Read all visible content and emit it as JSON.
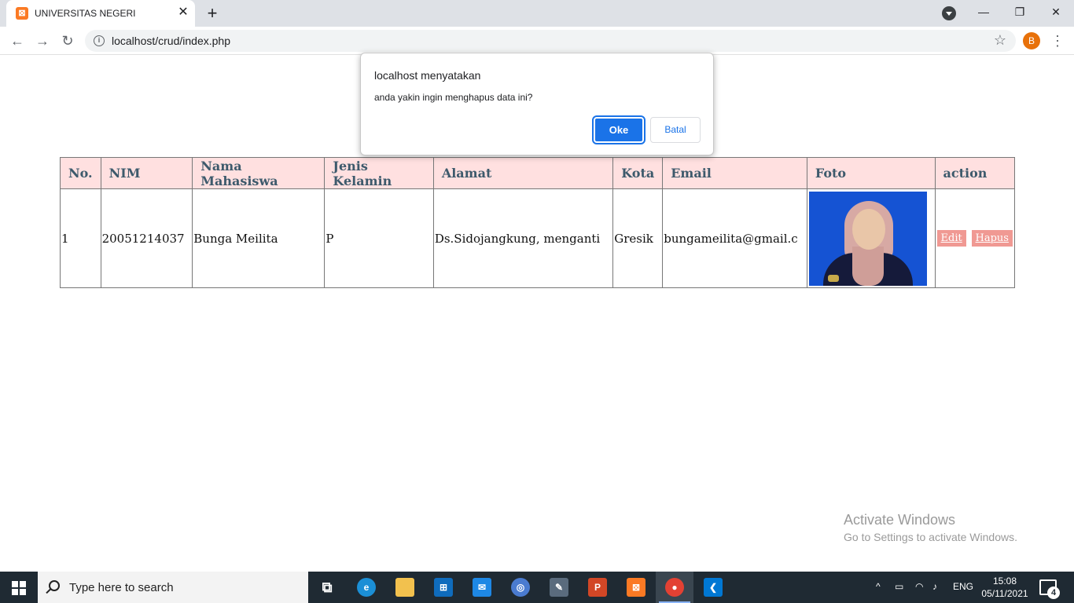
{
  "browser": {
    "tab_title": "UNIVERSITAS NEGERI",
    "tab_favicon": "xampp-icon",
    "url": "localhost/crud/index.php",
    "profile_initial": "B"
  },
  "table": {
    "headers": [
      "No.",
      "NIM",
      "Nama Mahasiswa",
      "Jenis Kelamin",
      "Alamat",
      "Kota",
      "Email",
      "Foto",
      "action"
    ],
    "rows": [
      {
        "no": "1",
        "nim": "20051214037",
        "nama": "Bunga Meilita",
        "jenis_kelamin": "P",
        "alamat": "Ds.Sidojangkung, menganti",
        "kota": "Gresik",
        "email": "bungameilita@gmail.c",
        "edit_label": "Edit",
        "hapus_label": "Hapus"
      }
    ]
  },
  "dialog": {
    "title": "localhost menyatakan",
    "message": "anda yakin ingin menghapus data ini?",
    "ok_label": "Oke",
    "cancel_label": "Batal"
  },
  "watermark": {
    "title": "Activate Windows",
    "subtitle": "Go to Settings to activate Windows."
  },
  "taskbar": {
    "search_placeholder": "Type here to search",
    "language": "ENG",
    "time": "15:08",
    "date": "05/11/2021",
    "notification_count": "4"
  },
  "colors": {
    "header_bg": "#ffe0e0",
    "header_text": "#3d5a6c",
    "action_btn": "#f09993",
    "dialog_primary": "#1a73e8",
    "taskbar_bg": "#1f2a33"
  }
}
